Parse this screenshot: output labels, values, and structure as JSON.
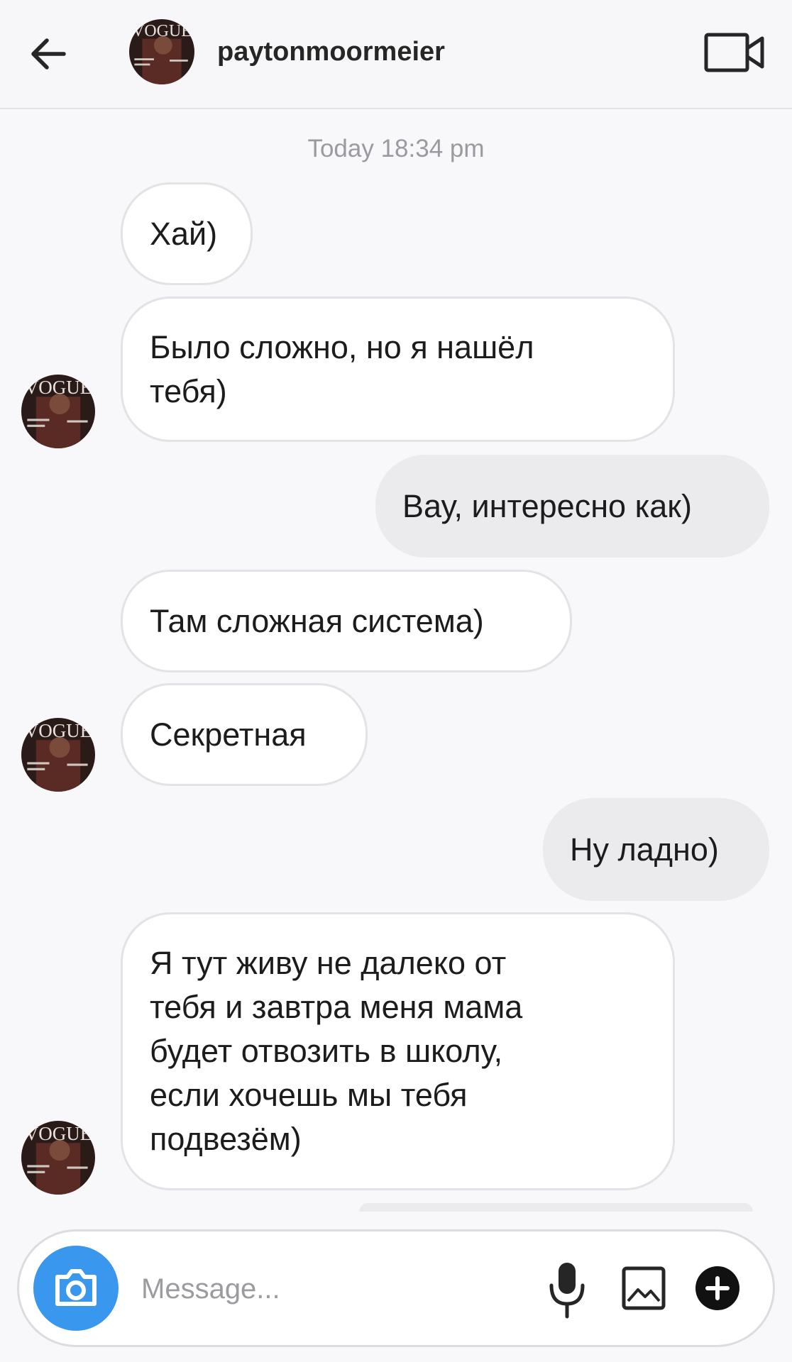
{
  "header": {
    "username": "paytonmoormeier",
    "avatar_logo": "VOGUE"
  },
  "chat": {
    "timestamp": "Today 18:34 pm",
    "messages": [
      {
        "from": "them",
        "text": "Хай)"
      },
      {
        "from": "them",
        "text": "Было сложно, но я нашёл\nтебя)"
      },
      {
        "from": "me",
        "text": "Вау, интересно как)"
      },
      {
        "from": "them",
        "text": "Там сложная система)"
      },
      {
        "from": "them",
        "text": "Секретная"
      },
      {
        "from": "me",
        "text": "Ну ладно)"
      },
      {
        "from": "them",
        "text": "Я тут живу не далеко от\nтебя и завтра меня мама\nбудет отвозить в школу,\nесли хочешь мы тебя\nподвезём)"
      }
    ]
  },
  "composer": {
    "placeholder": "Message..."
  },
  "icons": {
    "back": "arrow-left-icon",
    "video": "video-camera-icon",
    "camera": "camera-icon",
    "mic": "microphone-icon",
    "gallery": "image-gallery-icon",
    "plus": "plus-circle-icon"
  },
  "colors": {
    "accent": "#3a97ee",
    "incoming_bubble": "#ffffff",
    "outgoing_bubble": "#ebebee"
  }
}
